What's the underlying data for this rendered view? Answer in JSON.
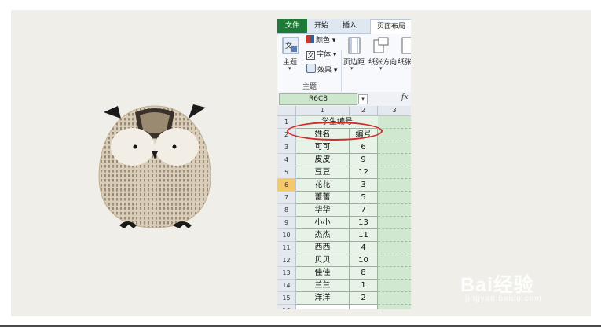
{
  "ribbon": {
    "tabs": [
      "文件",
      "开始",
      "插入",
      "页面布局"
    ],
    "themes_label": "主题",
    "colors_label": "颜色",
    "fonts_label": "字体",
    "effects_label": "效果",
    "group_label": "主题",
    "margins_label": "页边距",
    "orientation_label": "纸张方向",
    "size_label": "纸张"
  },
  "formula_bar": {
    "name_box": "R6C8",
    "fx_label": "fx"
  },
  "sheet": {
    "columns": [
      "1",
      "2",
      "3"
    ],
    "title": "学生编号",
    "headers": [
      "姓名",
      "编号"
    ],
    "rows": [
      {
        "num": "3",
        "name": "可可",
        "id": "6"
      },
      {
        "num": "4",
        "name": "皮皮",
        "id": "9"
      },
      {
        "num": "5",
        "name": "豆豆",
        "id": "12"
      },
      {
        "num": "6",
        "name": "花花",
        "id": "3"
      },
      {
        "num": "7",
        "name": "蕾蕾",
        "id": "5"
      },
      {
        "num": "8",
        "name": "华华",
        "id": "7"
      },
      {
        "num": "9",
        "name": "小小",
        "id": "13"
      },
      {
        "num": "10",
        "name": "杰杰",
        "id": "11"
      },
      {
        "num": "11",
        "name": "西西",
        "id": "4"
      },
      {
        "num": "12",
        "name": "贝贝",
        "id": "10"
      },
      {
        "num": "13",
        "name": "佳佳",
        "id": "8"
      },
      {
        "num": "14",
        "name": "兰兰",
        "id": "1"
      },
      {
        "num": "15",
        "name": "洋洋",
        "id": "2"
      }
    ],
    "row_numbers": [
      "1",
      "2",
      "16"
    ],
    "active_row": "6"
  },
  "watermark": {
    "main": "Bai经验",
    "sub": "jingyan.baidu.com"
  },
  "colors": {
    "file_tab": "#1f7a38",
    "cell_fill": "#cfe8cf",
    "highlight": "#d42a2a"
  }
}
